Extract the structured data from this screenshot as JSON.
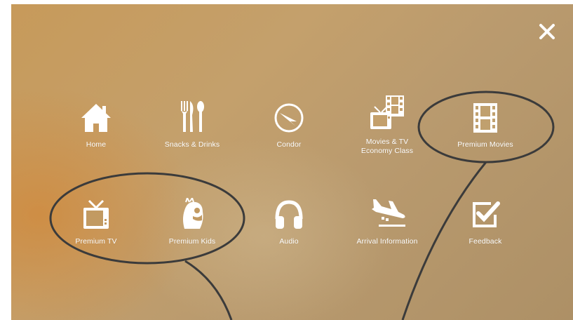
{
  "header": {
    "close_icon": "close-icon"
  },
  "menu": {
    "row1": [
      {
        "label": "Home",
        "icon": "home-icon"
      },
      {
        "label": "Snacks & Drinks",
        "icon": "cutlery-icon"
      },
      {
        "label": "Condor",
        "icon": "condor-logo-icon"
      },
      {
        "label": "Movies & TV\nEconomy Class",
        "icon": "tv-film-icon"
      },
      {
        "label": "Premium Movies",
        "icon": "film-icon"
      }
    ],
    "row2": [
      {
        "label": "Premium TV",
        "icon": "tv-icon"
      },
      {
        "label": "Premium Kids",
        "icon": "kids-character-icon"
      },
      {
        "label": "Audio",
        "icon": "headphones-icon"
      },
      {
        "label": "Arrival Information",
        "icon": "plane-landing-icon"
      },
      {
        "label": "Feedback",
        "icon": "checkbox-icon"
      }
    ]
  },
  "colors": {
    "icon": "#ffffff",
    "annotation": "#3a3a3a"
  }
}
